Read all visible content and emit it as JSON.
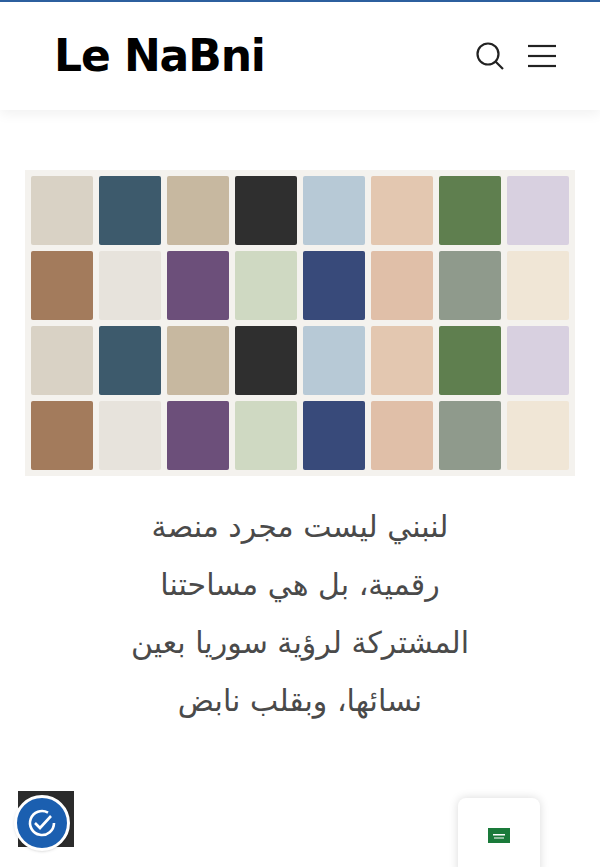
{
  "header": {
    "logo": "Le NaBni",
    "search_label": "Search",
    "menu_label": "Menu"
  },
  "hero": {
    "image": "collage"
  },
  "intro_lines": [
    "لنبني ليست مجرد منصة",
    "رقمية، بل هي مساحتنا",
    "المشتركة لرؤية سوريا بعين",
    "نسائها، وبقلب نابض"
  ],
  "accessibility": {
    "label": "Accessibility"
  },
  "language": {
    "flag": "sa"
  }
}
